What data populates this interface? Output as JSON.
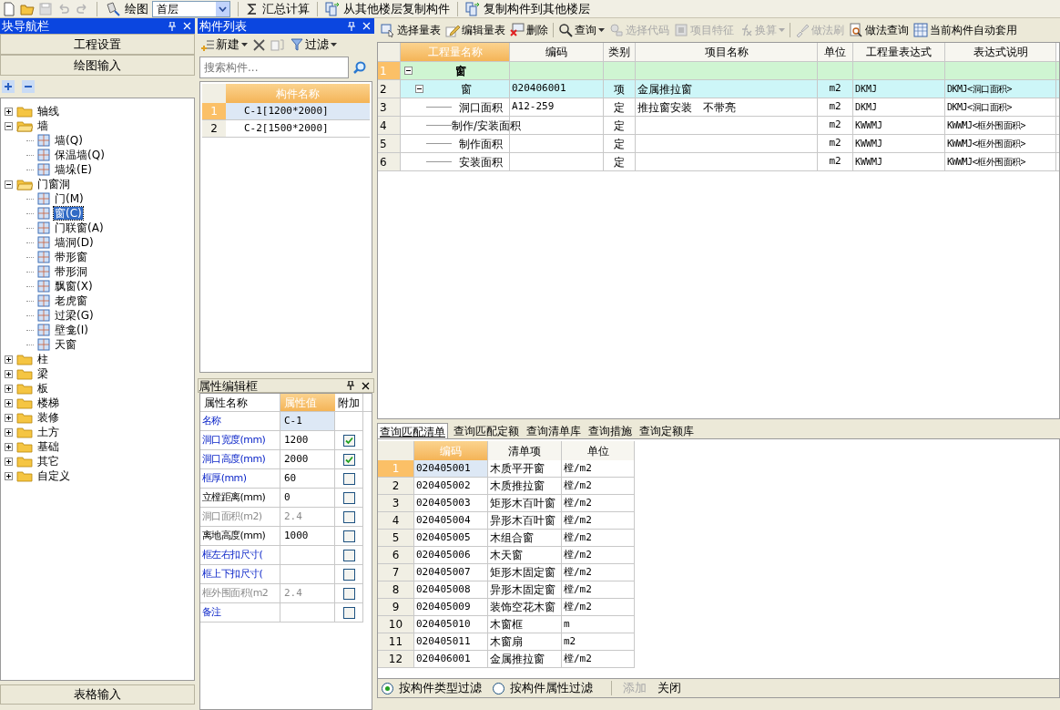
{
  "toolbar": {
    "quick_buttons": [
      {
        "kind": "new",
        "disabled": false
      },
      {
        "kind": "open",
        "disabled": false
      },
      {
        "kind": "save",
        "disabled": true
      },
      {
        "kind": "undo",
        "disabled": true
      },
      {
        "kind": "redo",
        "disabled": true
      }
    ],
    "draw_button": "绘图",
    "floor_select": "首层",
    "buttons": [
      {
        "kind": "sum",
        "label": "汇总计算"
      },
      {
        "kind": "copy",
        "label": "从其他楼层复制构件"
      },
      {
        "kind": "copy",
        "label": "复制构件到其他楼层"
      }
    ]
  },
  "nav_panel": {
    "title": "块导航栏",
    "sections": [
      "工程设置",
      "绘图输入"
    ],
    "tree": [
      {
        "label": "轴线",
        "expanded": false
      },
      {
        "label": "墙",
        "expanded": true,
        "children": [
          {
            "label": "墙(Q)",
            "selected": false
          },
          {
            "label": "保温墙(Q)",
            "selected": false
          },
          {
            "label": "墙垛(E)",
            "selected": false
          }
        ]
      },
      {
        "label": "门窗洞",
        "expanded": true,
        "children": [
          {
            "label": "门(M)",
            "selected": false
          },
          {
            "label": "窗(C)",
            "selected": true
          },
          {
            "label": "门联窗(A)",
            "selected": false
          },
          {
            "label": "墙洞(D)",
            "selected": false
          },
          {
            "label": "带形窗",
            "selected": false
          },
          {
            "label": "带形洞",
            "selected": false
          },
          {
            "label": "飘窗(X)",
            "selected": false
          },
          {
            "label": "老虎窗",
            "selected": false
          },
          {
            "label": "过梁(G)",
            "selected": false
          },
          {
            "label": "壁龛(I)",
            "selected": false
          },
          {
            "label": "天窗",
            "selected": false
          }
        ]
      },
      {
        "label": "柱",
        "expanded": false
      },
      {
        "label": "梁",
        "expanded": false
      },
      {
        "label": "板",
        "expanded": false
      },
      {
        "label": "楼梯",
        "expanded": false
      },
      {
        "label": "装修",
        "expanded": false
      },
      {
        "label": "土方",
        "expanded": false
      },
      {
        "label": "基础",
        "expanded": false
      },
      {
        "label": "其它",
        "expanded": false
      },
      {
        "label": "自定义",
        "expanded": false
      }
    ],
    "bottom_section": "表格输入"
  },
  "component_list": {
    "title": "构件列表",
    "new_button": "新建",
    "filter_button": "过滤",
    "search": {
      "placeholder": "搜索构件..."
    },
    "column": "构件名称",
    "rows": [
      {
        "number": "1",
        "name": "C-1[1200*2000]",
        "selected": true
      },
      {
        "number": "2",
        "name": "C-2[1500*2000]",
        "selected": false
      }
    ]
  },
  "property_editor": {
    "title": "属性编辑框",
    "columns": [
      "属性名称",
      "属性值",
      "附加"
    ],
    "rows": [
      {
        "kind": "public",
        "name": "名称",
        "value": "C-1",
        "selected": true
      },
      {
        "kind": "public",
        "name": "洞口宽度(mm)",
        "value": "1200",
        "checked": true,
        "selected": false
      },
      {
        "kind": "public",
        "name": "洞口高度(mm)",
        "value": "2000",
        "checked": true,
        "selected": false
      },
      {
        "kind": "public",
        "name": "框厚(mm)",
        "value": "60",
        "checked": false,
        "selected": false
      },
      {
        "kind": "private",
        "name": "立樘距离(mm)",
        "value": "0",
        "checked": false,
        "selected": false
      },
      {
        "kind": "readonly",
        "name": "洞口面积(m2)",
        "value": "2.4",
        "checked": false,
        "selected": false
      },
      {
        "kind": "private",
        "name": "离地高度(mm)",
        "value": "1000",
        "checked": false,
        "selected": false
      },
      {
        "kind": "public",
        "name": "框左右扣尺寸(",
        "checked": false,
        "selected": false
      },
      {
        "kind": "public",
        "name": "框上下扣尺寸(",
        "checked": false,
        "selected": false
      },
      {
        "kind": "readonly",
        "name": "框外围面积(m2",
        "value": "2.4",
        "checked": false,
        "selected": false
      },
      {
        "kind": "public",
        "name": "备注",
        "checked": false,
        "selected": false
      }
    ]
  },
  "quantity_toolbar": [
    {
      "kind": "select",
      "label": "选择量表",
      "disabled": false,
      "dropdown": false
    },
    {
      "kind": "edit",
      "label": "编辑量表",
      "disabled": false,
      "dropdown": false
    },
    {
      "kind": "delete",
      "label": "删除",
      "disabled": false,
      "dropdown": false
    },
    {
      "kind": "search",
      "label": "查询",
      "disabled": false,
      "dropdown": true
    },
    {
      "kind": "code",
      "label": "选择代码",
      "disabled": true,
      "dropdown": false
    },
    {
      "kind": "feature",
      "label": "项目特征",
      "disabled": true,
      "dropdown": false
    },
    {
      "kind": "fx",
      "label": "换算",
      "disabled": true,
      "dropdown": true
    },
    {
      "kind": "brush",
      "label": "做法刷",
      "disabled": true,
      "dropdown": false
    },
    {
      "kind": "query",
      "label": "做法查询",
      "disabled": false,
      "dropdown": false
    },
    {
      "kind": "auto",
      "label": "当前构件自动套用",
      "disabled": false,
      "dropdown": false
    }
  ],
  "quantity_table": {
    "columns": [
      "工程量名称",
      "编码",
      "类别",
      "项目名称",
      "单位",
      "工程量表达式",
      "表达式说明"
    ],
    "rows": [
      {
        "kind": "group",
        "number": "1",
        "name": "窗",
        "selected": true,
        "expanded": true,
        "children": [
          {
            "kind": "item",
            "number": "2",
            "name": "窗",
            "code": "020406001",
            "type": "项",
            "item": "金属推拉窗",
            "unit": "m2",
            "expression": "DKMJ",
            "description": "DKMJ<洞口面积>",
            "selected": false,
            "expanded": true,
            "children": [
              {
                "kind": "sub",
                "number": "3",
                "name": "洞口面积",
                "code": "A12-259",
                "type": "定",
                "item": "推拉窗安装　不带亮",
                "unit": "m2",
                "expression": "DKMJ",
                "description": "DKMJ<洞口面积>",
                "selected": false
              },
              {
                "kind": "sub",
                "number": "4",
                "name": "制作/安装面积",
                "type": "定",
                "unit": "m2",
                "expression": "KWWMJ",
                "description": "KWWMJ<框外围面积>",
                "selected": false
              },
              {
                "kind": "sub",
                "number": "5",
                "name": "制作面积",
                "type": "定",
                "unit": "m2",
                "expression": "KWWMJ",
                "description": "KWWMJ<框外围面积>",
                "selected": false
              },
              {
                "kind": "sub",
                "number": "6",
                "name": "安装面积",
                "type": "定",
                "unit": "m2",
                "expression": "KWWMJ",
                "description": "KWWMJ<框外围面积>",
                "selected": false
              }
            ]
          }
        ]
      }
    ]
  },
  "query_panel": {
    "tabs": [
      {
        "label": "查询匹配清单",
        "selected": true
      },
      {
        "label": "查询匹配定额",
        "selected": false
      },
      {
        "label": "查询清单库",
        "selected": false
      },
      {
        "label": "查询措施",
        "selected": false
      },
      {
        "label": "查询定额库",
        "selected": false
      }
    ],
    "columns": [
      "编码",
      "清单项",
      "单位"
    ],
    "rows": [
      {
        "number": "1",
        "code": "020405001",
        "item": "木质平开窗",
        "unit": "樘/m2",
        "selected": true
      },
      {
        "number": "2",
        "code": "020405002",
        "item": "木质推拉窗",
        "unit": "樘/m2",
        "selected": false
      },
      {
        "number": "3",
        "code": "020405003",
        "item": "矩形木百叶窗",
        "unit": "樘/m2",
        "selected": false
      },
      {
        "number": "4",
        "code": "020405004",
        "item": "异形木百叶窗",
        "unit": "樘/m2",
        "selected": false
      },
      {
        "number": "5",
        "code": "020405005",
        "item": "木组合窗",
        "unit": "樘/m2",
        "selected": false
      },
      {
        "number": "6",
        "code": "020405006",
        "item": "木天窗",
        "unit": "樘/m2",
        "selected": false
      },
      {
        "number": "7",
        "code": "020405007",
        "item": "矩形木固定窗",
        "unit": "樘/m2",
        "selected": false
      },
      {
        "number": "8",
        "code": "020405008",
        "item": "异形木固定窗",
        "unit": "樘/m2",
        "selected": false
      },
      {
        "number": "9",
        "code": "020405009",
        "item": "装饰空花木窗",
        "unit": "樘/m2",
        "selected": false
      },
      {
        "number": "10",
        "code": "020405010",
        "item": "木窗框",
        "unit": "m",
        "selected": false
      },
      {
        "number": "11",
        "code": "020405011",
        "item": "木窗扇",
        "unit": "m2",
        "selected": false
      },
      {
        "number": "12",
        "code": "020406001",
        "item": "金属推拉窗",
        "unit": "樘/m2",
        "selected": false
      }
    ],
    "filters": [
      {
        "label": "按构件类型过滤",
        "selected": true
      },
      {
        "label": "按构件属性过滤",
        "selected": false
      }
    ],
    "buttons": [
      {
        "label": "添加",
        "disabled": true
      },
      {
        "label": "关闭",
        "disabled": false
      }
    ]
  }
}
